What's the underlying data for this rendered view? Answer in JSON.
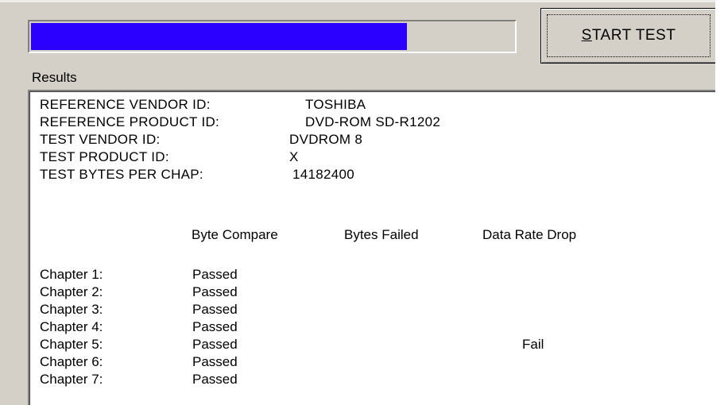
{
  "progress": {
    "fraction": 0.78,
    "fill_color": "#2c00ff"
  },
  "start_button": {
    "label_underlined": "S",
    "label_rest": "TART TEST"
  },
  "results": {
    "label": "Results",
    "info": [
      {
        "key": "REFERENCE VENDOR ID:",
        "value": "TOSHIBA"
      },
      {
        "key": "REFERENCE PRODUCT ID:",
        "value": "DVD-ROM SD-R1202"
      },
      {
        "key": "TEST VENDOR ID:",
        "value": "DVDROM 8"
      },
      {
        "key": "TEST PRODUCT ID:",
        "value": "X"
      },
      {
        "key": "TEST BYTES PER CHAP:",
        "value": "14182400"
      }
    ],
    "columns": [
      "Byte Compare",
      "Bytes Failed",
      "Data Rate Drop"
    ],
    "chapters": [
      {
        "name": "Chapter 1:",
        "byte_compare": "Passed",
        "bytes_failed": "",
        "data_rate_drop": ""
      },
      {
        "name": "Chapter 2:",
        "byte_compare": "Passed",
        "bytes_failed": "",
        "data_rate_drop": ""
      },
      {
        "name": "Chapter 3:",
        "byte_compare": "Passed",
        "bytes_failed": "",
        "data_rate_drop": ""
      },
      {
        "name": "Chapter 4:",
        "byte_compare": "Passed",
        "bytes_failed": "",
        "data_rate_drop": ""
      },
      {
        "name": "Chapter 5:",
        "byte_compare": "Passed",
        "bytes_failed": "",
        "data_rate_drop": "Fail"
      },
      {
        "name": "Chapter 6:",
        "byte_compare": "Passed",
        "bytes_failed": "",
        "data_rate_drop": ""
      },
      {
        "name": "Chapter 7:",
        "byte_compare": "Passed",
        "bytes_failed": "",
        "data_rate_drop": ""
      }
    ]
  }
}
